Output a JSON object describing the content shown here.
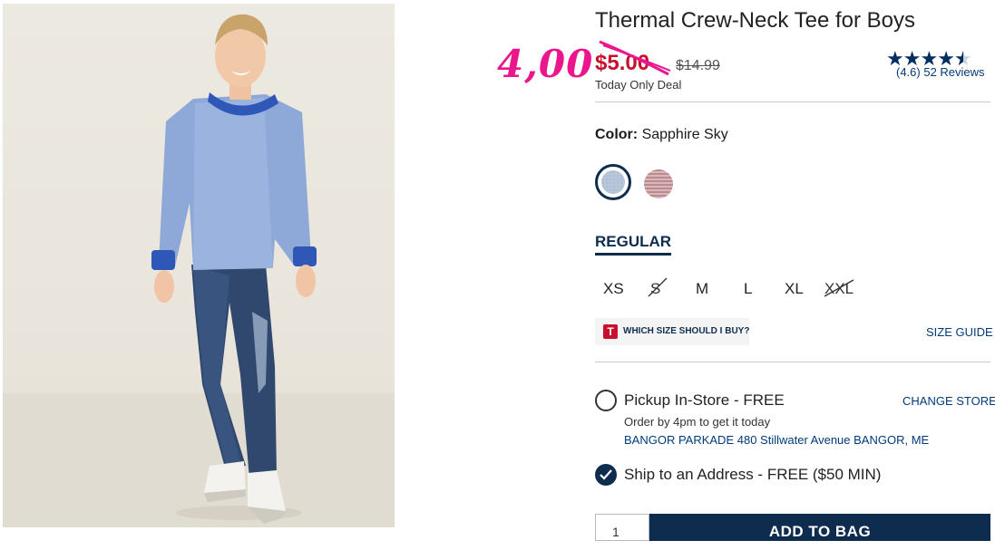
{
  "annotation": {
    "handwritten_price": "4,00"
  },
  "product": {
    "title": "Thermal Crew-Neck Tee for Boys",
    "sale_price": "$5.00",
    "original_price": "$14.99",
    "deal_text": "Today Only Deal",
    "rating": {
      "stars": 4.6,
      "label": "(4.6) 52 Reviews"
    }
  },
  "color": {
    "label": "Color:",
    "selected": "Sapphire Sky",
    "swatches": [
      "sapphire-sky",
      "pink-heather"
    ]
  },
  "fit": {
    "active_tab": "REGULAR"
  },
  "sizes": [
    {
      "label": "XS",
      "available": true
    },
    {
      "label": "S",
      "available": false
    },
    {
      "label": "M",
      "available": true
    },
    {
      "label": "L",
      "available": true
    },
    {
      "label": "XL",
      "available": true
    },
    {
      "label": "XXL",
      "available": false
    }
  ],
  "size_help": {
    "badge": "T",
    "label": "WHICH SIZE SHOULD I BUY?",
    "guide_link": "SIZE GUIDE"
  },
  "fulfillment": {
    "pickup": {
      "label": "Pickup In-Store - FREE",
      "change_link": "CHANGE STORE",
      "note": "Order by 4pm to get it today",
      "store": "BANGOR PARKADE 480 Stillwater Avenue  BANGOR, ME",
      "selected": false
    },
    "ship": {
      "label": "Ship to an Address - FREE ($50 MIN)",
      "selected": true
    }
  },
  "purchase": {
    "quantity": "1",
    "add_to_bag": "ADD TO BAG"
  },
  "colors": {
    "navy": "#0e2d4e",
    "sale_red": "#c8102e",
    "link_blue": "#003b7a",
    "annotation_pink": "#ec168c"
  }
}
